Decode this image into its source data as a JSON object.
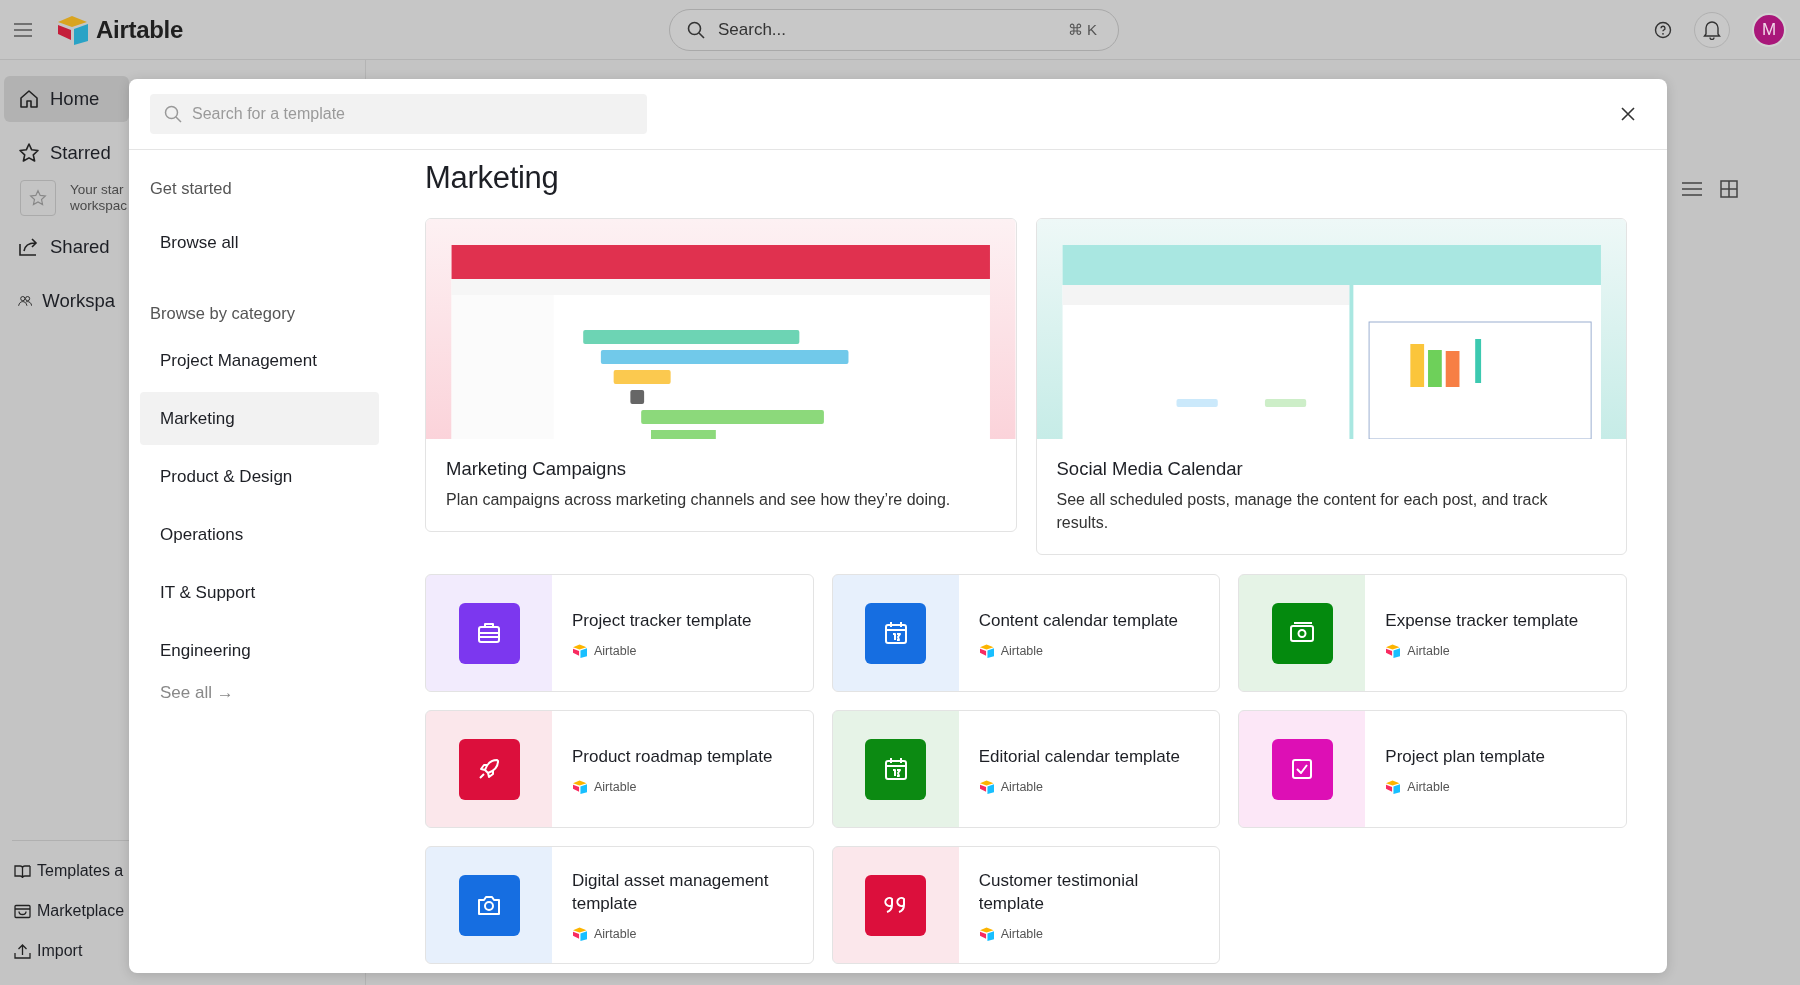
{
  "topbar": {
    "brand": "Airtable",
    "search": {
      "placeholder": "Search...",
      "shortcut": "⌘ K"
    },
    "avatar": "M"
  },
  "sidebar": {
    "items": [
      {
        "label": "Home",
        "selected": true
      },
      {
        "label": "Starred",
        "selected": false
      },
      {
        "label": "Shared",
        "selected": false
      },
      {
        "label": "Workspa",
        "selected": false
      }
    ],
    "starred_hint": [
      "Your star",
      "workspac"
    ],
    "bottom": [
      "Templates a",
      "Marketplace",
      "Import"
    ]
  },
  "modal": {
    "search": {
      "placeholder": "Search for a template"
    },
    "nav": [
      {
        "heading": "Get started",
        "items": [
          {
            "label": "Browse all",
            "selected": false
          }
        ]
      },
      {
        "heading": "Browse by category",
        "items": [
          {
            "label": "Project Management",
            "selected": false
          },
          {
            "label": "Marketing",
            "selected": true
          },
          {
            "label": "Product & Design",
            "selected": false
          },
          {
            "label": "Operations",
            "selected": false
          },
          {
            "label": "IT & Support",
            "selected": false
          },
          {
            "label": "Engineering",
            "selected": false
          }
        ]
      }
    ],
    "see_all": "See all →",
    "heading": "Marketing",
    "featured": [
      {
        "kind": "gantt",
        "title": "Marketing Campaigns",
        "description": "Plan campaigns across marketing channels and see how they’re doing."
      },
      {
        "kind": "calendar",
        "title": "Social Media Calendar",
        "description": "See all scheduled posts, manage the content for each post, and track results."
      }
    ],
    "templates": [
      {
        "title": "Project tracker template",
        "source": "Airtable",
        "color": "#7c37ef"
      },
      {
        "title": "Content calendar template",
        "source": "Airtable",
        "color": "#166ee1"
      },
      {
        "title": "Expense tracker template",
        "source": "Airtable",
        "color": "#048a0e"
      },
      {
        "title": "Product roadmap template",
        "source": "Airtable",
        "color": "#dc0f3c"
      },
      {
        "title": "Editorial calendar template",
        "source": "Airtable",
        "color": "#0c8a12"
      },
      {
        "title": "Project plan template",
        "source": "Airtable",
        "color": "#dd0fb5"
      },
      {
        "title": "Digital asset management template",
        "source": "Airtable",
        "color": "#166ee1"
      },
      {
        "title": "Customer testimonial template",
        "source": "Airtable",
        "color": "#dc0f3c"
      }
    ]
  }
}
